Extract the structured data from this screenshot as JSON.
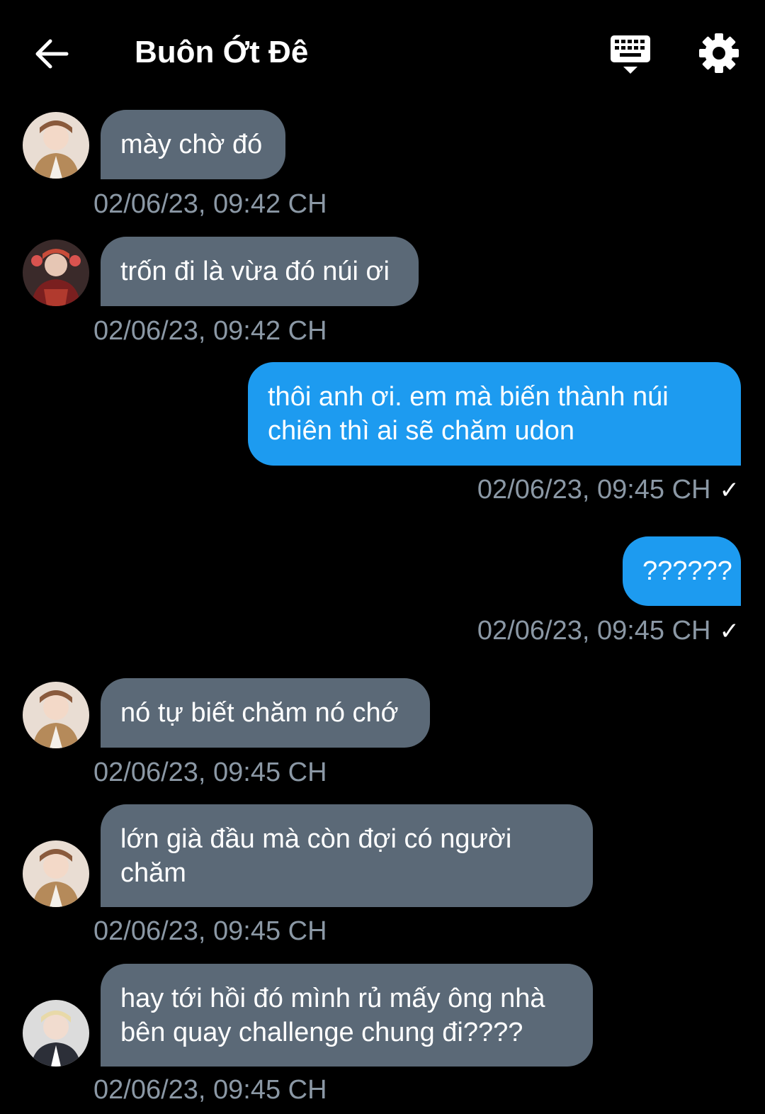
{
  "header": {
    "title": "Buôn Ớt Đê",
    "back_icon": "arrow-left-icon",
    "keyboard_icon": "keyboard-hide-icon",
    "settings_icon": "gear-icon"
  },
  "colors": {
    "background": "#000000",
    "incoming_bubble": "#5b6977",
    "outgoing_bubble": "#1d9bf0",
    "timestamp": "#8b98a5"
  },
  "messages": [
    {
      "direction": "in",
      "text": "mày chờ đó",
      "time": "02/06/23, 09:42 CH"
    },
    {
      "direction": "in",
      "text": "trốn đi là vừa đó núi ơi",
      "time": "02/06/23, 09:42 CH"
    },
    {
      "direction": "out",
      "text": "thôi anh ơi. em mà biến thành núi\nchiên thì ai sẽ chăm udon",
      "time": "02/06/23, 09:45 CH",
      "read_check": "✓"
    },
    {
      "direction": "out",
      "text": "??????",
      "time": "02/06/23, 09:45 CH",
      "read_check": "✓"
    },
    {
      "direction": "in",
      "text": "nó tự biết chăm nó chớ",
      "time": "02/06/23, 09:45 CH"
    },
    {
      "direction": "in",
      "text": "lớn già đầu mà còn đợi có người\nchăm",
      "time": "02/06/23, 09:45 CH"
    },
    {
      "direction": "in",
      "text": "hay tới hồi đó mình rủ mấy ông nhà\nbên quay challenge chung đi????",
      "time": "02/06/23, 09:45 CH"
    }
  ]
}
